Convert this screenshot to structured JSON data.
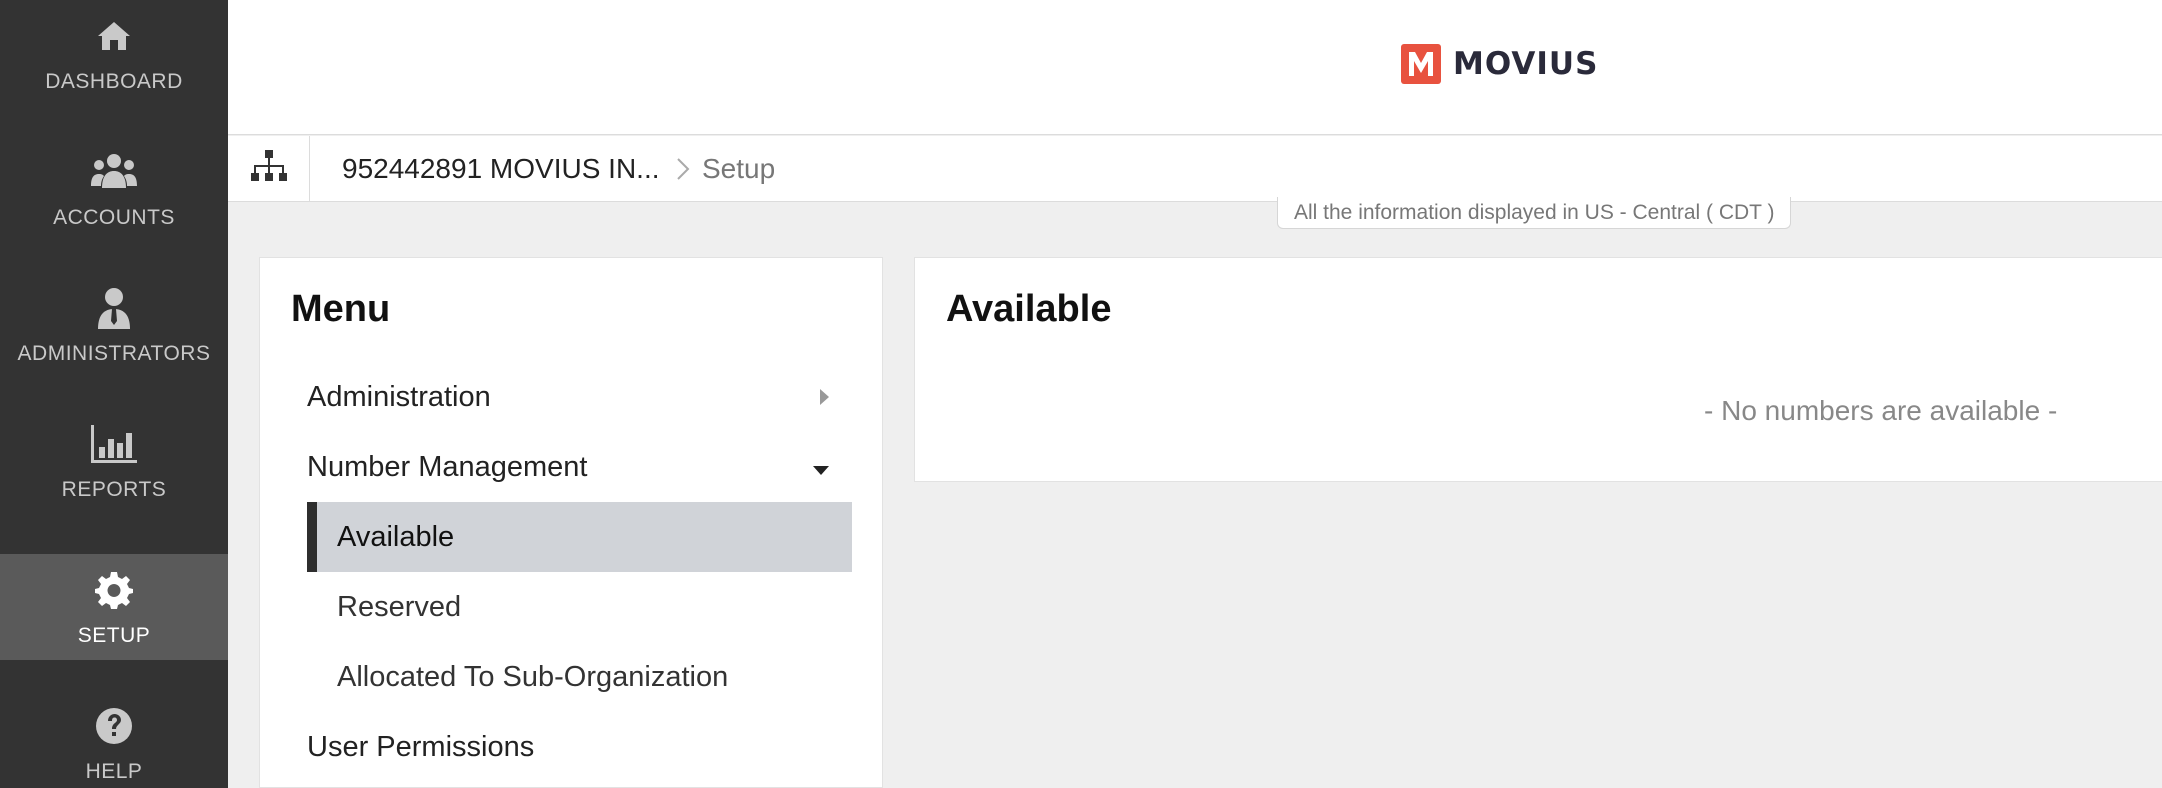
{
  "sidebar": {
    "items": [
      {
        "label": "DASHBOARD",
        "icon": "home-icon"
      },
      {
        "label": "ACCOUNTS",
        "icon": "users-icon"
      },
      {
        "label": "ADMINISTRATORS",
        "icon": "admin-user-icon"
      },
      {
        "label": "REPORTS",
        "icon": "bar-chart-icon"
      },
      {
        "label": "SETUP",
        "icon": "gear-icon",
        "active": true
      },
      {
        "label": "HELP",
        "icon": "question-circle-icon"
      }
    ]
  },
  "header": {
    "logo_text": "MOVIUS",
    "logo_color": "#e8523f"
  },
  "breadcrumb": {
    "org": "952442891 MOVIUS IN...",
    "current": "Setup"
  },
  "timezone_note": "All the information displayed in US - Central ( CDT )",
  "menu": {
    "title": "Menu",
    "items": [
      {
        "label": "Administration",
        "expanded": false
      },
      {
        "label": "Number Management",
        "expanded": true
      },
      {
        "label": "User Permissions"
      }
    ],
    "number_management": [
      {
        "label": "Available",
        "selected": true
      },
      {
        "label": "Reserved"
      },
      {
        "label": "Allocated To Sub-Organization"
      }
    ]
  },
  "available": {
    "title": "Available",
    "empty_message": "- No numbers are available -"
  }
}
